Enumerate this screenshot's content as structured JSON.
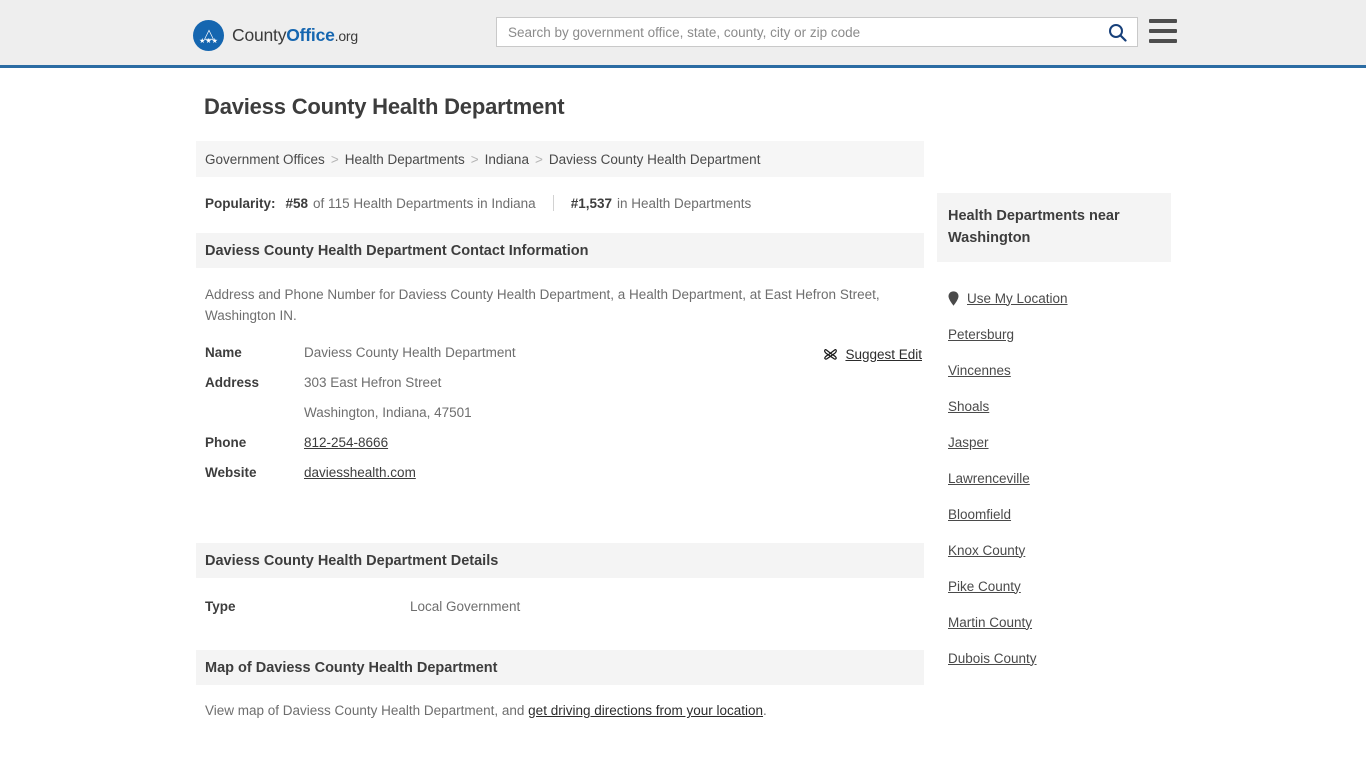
{
  "header": {
    "logo": {
      "part1": "County",
      "part2": "Office",
      "part3": ".org",
      "icon": "eagle-seal-icon"
    },
    "search": {
      "placeholder": "Search by government office, state, county, city or zip code",
      "value": "",
      "icon": "search-icon"
    },
    "menu_icon": "hamburger-menu-icon",
    "accent_color": "#2b6ca3",
    "background_color": "#eeeeee"
  },
  "page": {
    "title": "Daviess County Health Department"
  },
  "breadcrumb": {
    "separator": ">",
    "items": [
      {
        "label": "Government Offices",
        "current": false
      },
      {
        "label": "Health Departments",
        "current": false
      },
      {
        "label": "Indiana",
        "current": false
      },
      {
        "label": "Daviess County Health Department",
        "current": true
      }
    ]
  },
  "popularity": {
    "label": "Popularity:",
    "state_rank": "#58",
    "state_text": "of 115 Health Departments in Indiana",
    "national_rank": "#1,537",
    "national_text": "in Health Departments"
  },
  "contact": {
    "heading": "Daviess County Health Department Contact Information",
    "description": "Address and Phone Number for Daviess County Health Department, a Health Department, at East Hefron Street, Washington IN.",
    "suggest_edit": {
      "label": "Suggest Edit",
      "icon": "pencil-edit-icon"
    },
    "rows": [
      {
        "key": "Name",
        "value": "Daviess County Health Department",
        "link": false
      },
      {
        "key": "Address",
        "value": "303 East Hefron Street",
        "link": false
      },
      {
        "key": "",
        "value": "Washington, Indiana, 47501",
        "link": false
      },
      {
        "key": "Phone",
        "value": "812-254-8666",
        "link": true
      },
      {
        "key": "Website",
        "value": "daviesshealth.com",
        "link": true
      }
    ]
  },
  "details": {
    "heading": "Daviess County Health Department Details",
    "rows": [
      {
        "key": "Type",
        "value": "Local Government"
      }
    ]
  },
  "map": {
    "heading": "Map of Daviess County Health Department",
    "description_prefix": "View map of Daviess County Health Department, and ",
    "link_label": "get driving directions from your location",
    "description_suffix": "."
  },
  "sidebar": {
    "heading": "Health Departments near Washington",
    "use_my_location": {
      "label": "Use My Location",
      "icon": "map-pin-icon"
    },
    "items": [
      {
        "label": "Petersburg"
      },
      {
        "label": "Vincennes"
      },
      {
        "label": "Shoals"
      },
      {
        "label": "Jasper"
      },
      {
        "label": "Lawrenceville"
      },
      {
        "label": "Bloomfield"
      },
      {
        "label": "Knox County"
      },
      {
        "label": "Pike County"
      },
      {
        "label": "Martin County"
      },
      {
        "label": "Dubois County"
      }
    ]
  }
}
